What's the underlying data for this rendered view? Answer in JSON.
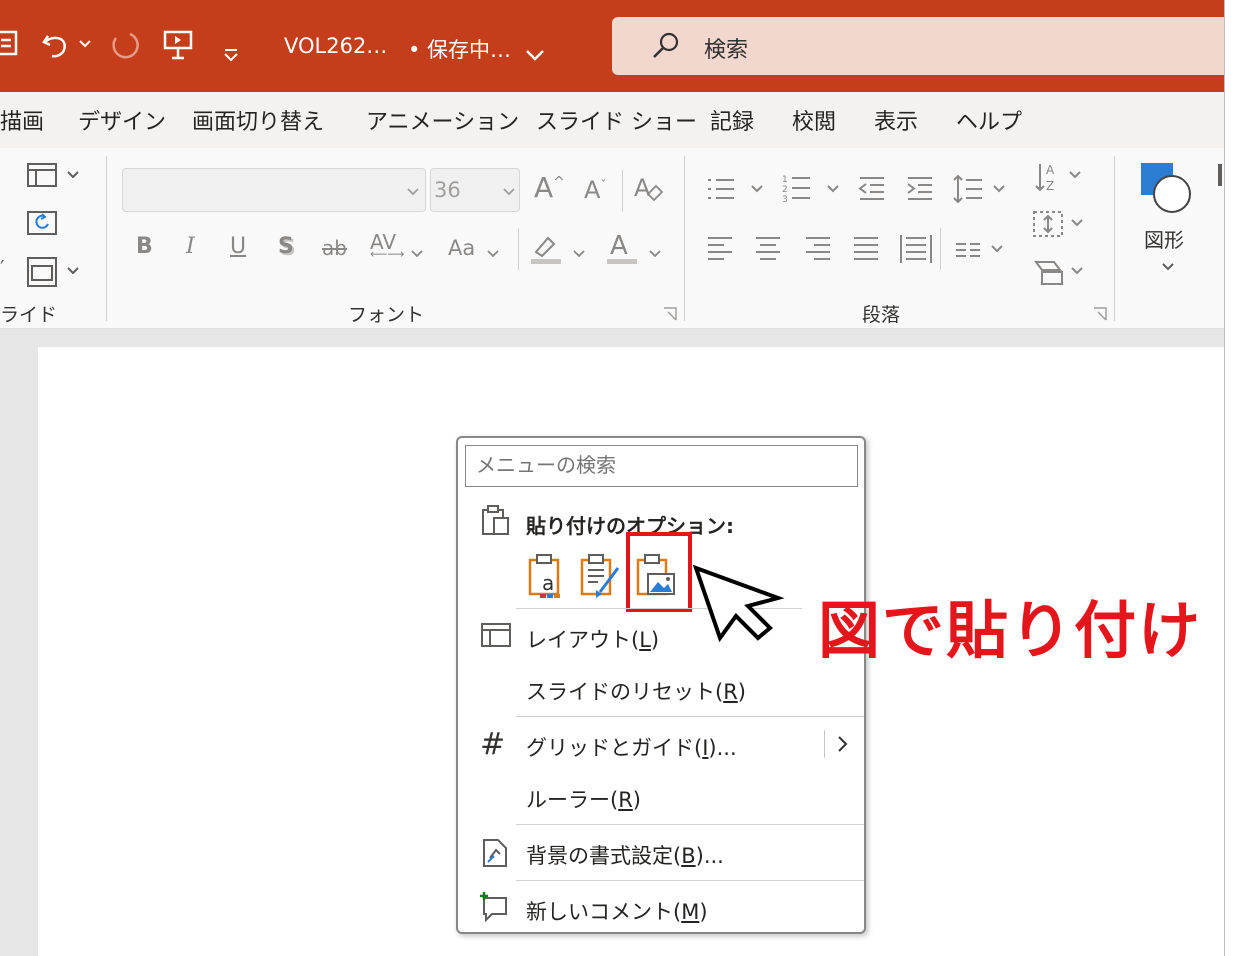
{
  "titlebar": {
    "filename": "VOL262…",
    "save_status": "• 保存中…",
    "search_label": "検索",
    "bg_color": "#c43e1c"
  },
  "tabs": [
    "描画",
    "デザイン",
    "画面切り替え",
    "アニメーション",
    "スライド ショー",
    "記録",
    "校閲",
    "表示",
    "ヘルプ"
  ],
  "ribbon": {
    "slides_group_label": "ライド",
    "font_group_label": "フォント",
    "paragraph_group_label": "段落",
    "font_size": "36",
    "shapes_label": "図形",
    "bold": "B",
    "italic": "I",
    "underline": "U",
    "shadow": "S",
    "strike": "ab",
    "spacing": "AV",
    "case": "Aa",
    "grow": "A",
    "shrink": "A"
  },
  "menu": {
    "search_placeholder": "メニューの検索",
    "paste_header": "貼り付けのオプション:",
    "items": [
      {
        "label": "レイアウト(",
        "key": "L",
        "suffix": ")"
      },
      {
        "label": "スライドのリセット(",
        "key": "R",
        "suffix": ")"
      },
      {
        "label": "グリッドとガイド(",
        "key": "I",
        "suffix": ")..."
      },
      {
        "label": "ルーラー(",
        "key": "R",
        "suffix": ")"
      },
      {
        "label": "背景の書式設定(",
        "key": "B",
        "suffix": ")..."
      },
      {
        "label": "新しいコメント(",
        "key": "M",
        "suffix": ")"
      }
    ]
  },
  "annotation": {
    "text": "図で貼り付け",
    "color": "#e5161b"
  }
}
